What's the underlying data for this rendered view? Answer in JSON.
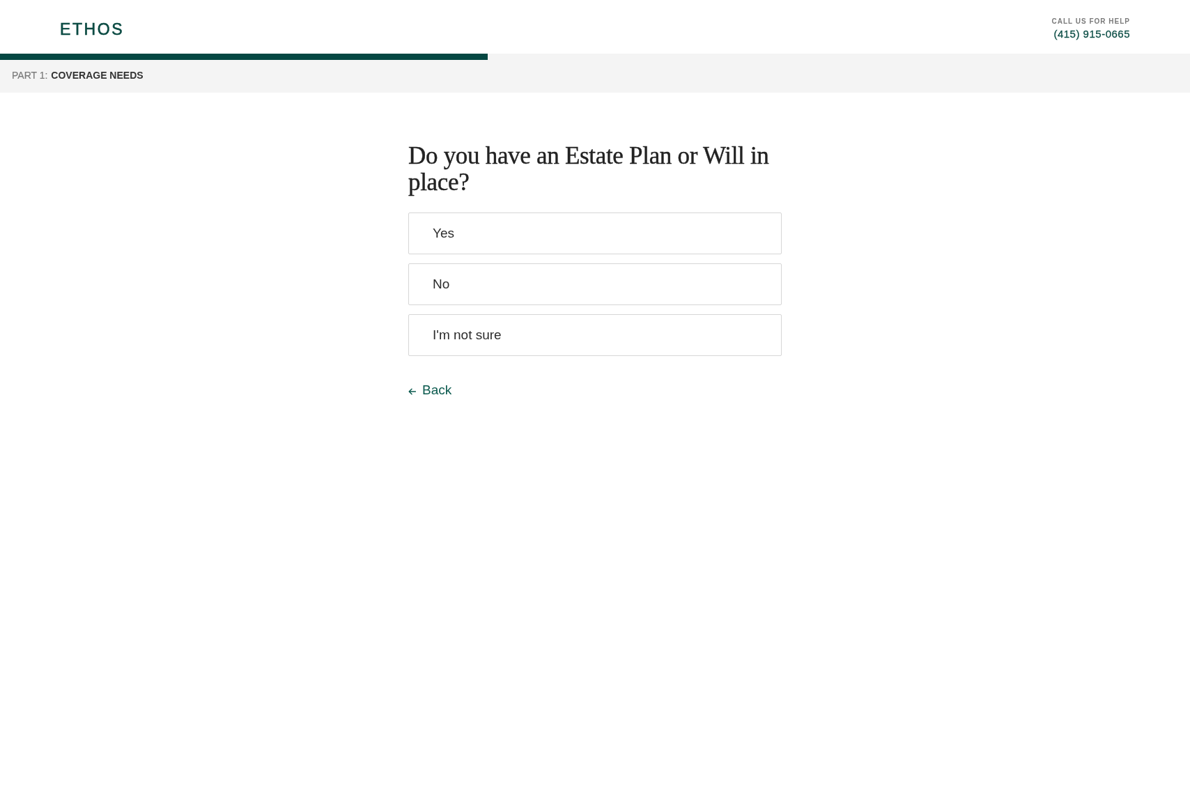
{
  "header": {
    "logo": "ETHOS",
    "help_label": "CALL US FOR HELP",
    "phone": "(415) 915-0665"
  },
  "progress": {
    "level": 0.41
  },
  "section": {
    "part": "PART 1:",
    "name": "COVERAGE NEEDS"
  },
  "question": {
    "title": "Do you have an Estate Plan or Will in place?",
    "options": [
      {
        "label": "Yes",
        "selected": false
      },
      {
        "label": "No",
        "selected": false
      },
      {
        "label": "I'm not sure",
        "selected": false
      }
    ]
  },
  "back_link": {
    "label": "Back"
  }
}
